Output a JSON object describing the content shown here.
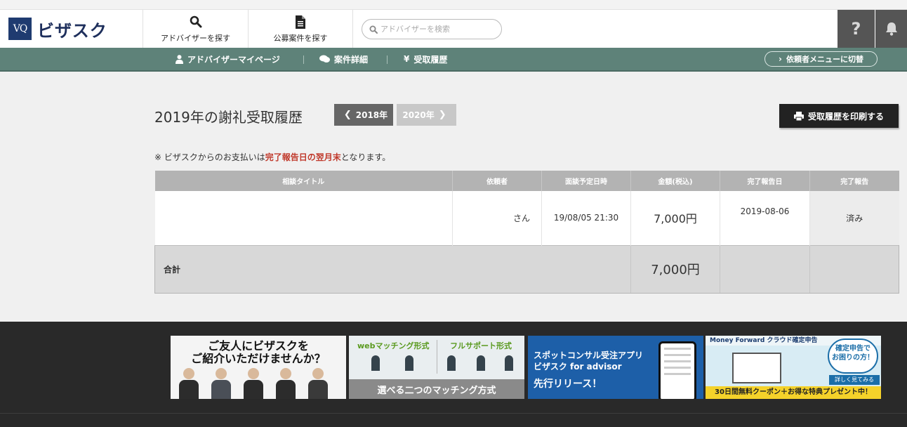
{
  "header": {
    "logo_mark": "VQ",
    "logo_text": "ビザスク",
    "nav": [
      {
        "label": "アドバイザーを探す",
        "icon": "search-icon"
      },
      {
        "label": "公募案件を探す",
        "icon": "document-icon"
      }
    ],
    "search_placeholder": "アドバイザーを検索",
    "help_label": "?"
  },
  "subnav": {
    "items": [
      {
        "label": "アドバイザーマイページ",
        "icon": "user-icon"
      },
      {
        "label": "案件詳細",
        "icon": "chat-icon"
      },
      {
        "label": "受取履歴",
        "icon": "yen-icon",
        "glyph": "¥"
      }
    ],
    "switch_label": "依頼者メニューに切替"
  },
  "main": {
    "title": "2019年の謝礼受取履歴",
    "prev_year": "2018年",
    "next_year": "2020年",
    "print_label": "受取履歴を印刷する",
    "note_prefix": "※ ビザスクからのお支払いは",
    "note_highlight": "完了報告日の翌月末",
    "note_suffix": "となります。"
  },
  "table": {
    "headers": [
      "相談タイトル",
      "依頼者",
      "面談予定日時",
      "金額(税込)",
      "完了報告日",
      "完了報告"
    ],
    "rows": [
      {
        "title": "",
        "client": "さん",
        "datetime": "19/08/05 21:30",
        "amount": "7,000円",
        "report_date": "2019-08-06",
        "status": "済み"
      }
    ],
    "total_label": "合計",
    "total_amount": "7,000円"
  },
  "footer": {
    "banner1_text": "ご友人にビザスクを\nご紹介いただけませんか？",
    "banner2_left": "webマッチング形式",
    "banner2_right": "フルサポート形式",
    "banner2_bottom": "選べる二つのマッチング方式",
    "banner3_line1": "スポットコンサル受注アプリ\nビザスク for advisor",
    "banner3_line2": "先行リリース！",
    "banner4_header": "Money Forward クラウド確定申告",
    "banner4_badge": "確定申告で\nお困りの方！",
    "banner4_more": "詳しく見てみる",
    "banner4_bottom": "30日間無料クーポン＋お得な特典プレゼント中！"
  },
  "colors": {
    "subnav_bg": "#5e8279",
    "highlight_red": "#c0392b",
    "logo_blue": "#1f3b70",
    "footer_bg": "#292929"
  }
}
